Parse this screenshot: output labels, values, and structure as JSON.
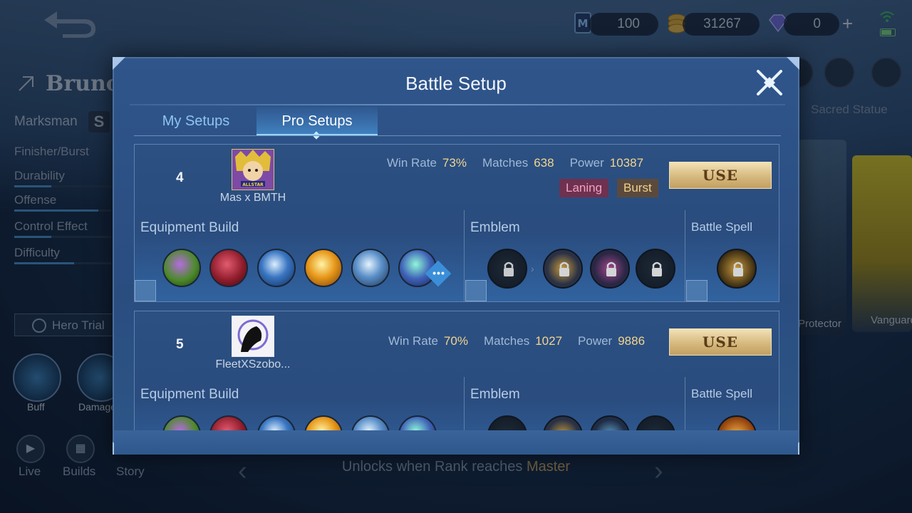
{
  "topbar": {
    "tickets": "100",
    "gold": "31267",
    "diamonds": "0",
    "add_symbol": "+"
  },
  "hero": {
    "name": "Bruno",
    "role": "Marksman",
    "stats": [
      {
        "label": "Finisher/Burst",
        "level": null
      },
      {
        "label": "Durability",
        "level": 0.38
      },
      {
        "label": "Offense",
        "level": 0.87
      },
      {
        "label": "Control Effect",
        "level": 0.38
      },
      {
        "label": "Difficulty",
        "level": 0.62
      }
    ],
    "hero_trial_label": "Hero Trial",
    "skills": [
      {
        "label": "Buff"
      },
      {
        "label": "Damage"
      }
    ]
  },
  "bottom_nav": [
    {
      "label": "Live"
    },
    {
      "label": "Builds"
    },
    {
      "label": "Story"
    }
  ],
  "unlock": {
    "prefix": "Unlocks when Rank reaches",
    "rank": "Master"
  },
  "right_panel": {
    "title": "Sacred Statue",
    "card1_label": "Protector",
    "card2_label": "Vanguard"
  },
  "modal": {
    "title": "Battle Setup",
    "tabs": [
      {
        "label": "My Setups",
        "active": false
      },
      {
        "label": "Pro Setups",
        "active": true
      }
    ],
    "labels": {
      "win_rate": "Win Rate",
      "matches": "Matches",
      "power": "Power",
      "equipment": "Equipment Build",
      "emblem": "Emblem",
      "spell": "Battle Spell",
      "use": "USE"
    },
    "setups": [
      {
        "rank": "4",
        "player": "Mas x BMTH",
        "win_rate": "73%",
        "matches": "638",
        "power": "10387",
        "tags": [
          "Laning",
          "Burst"
        ],
        "equipment": [
          "boots-icon",
          "claw-icon",
          "crescent-blade-icon",
          "golden-spear-icon",
          "bow-icon",
          "trident-icon"
        ],
        "emblems": [
          "emblem-locked-icon",
          "emblem-locked-icon",
          "emblem-locked-icon",
          "emblem-locked-icon"
        ],
        "spell": "spell-locked-icon"
      },
      {
        "rank": "5",
        "player": "FleetXSzobo...",
        "win_rate": "70%",
        "matches": "1027",
        "power": "9886",
        "tags": [],
        "equipment": [
          "boots-icon",
          "claw-icon",
          "crescent-blade-icon",
          "golden-spear-icon",
          "bow-icon",
          "trident-icon"
        ],
        "emblems": [
          "emblem-icon",
          "emblem-icon",
          "emblem-icon",
          "emblem-icon"
        ],
        "spell": "spell-icon"
      }
    ]
  },
  "colors": {
    "accent_gold": "#f2d58e",
    "tab_active": "#9bd6ff",
    "use_button": "#d6b97e",
    "tag_laning": "#6e3150",
    "tag_burst": "#5b4a3c"
  }
}
